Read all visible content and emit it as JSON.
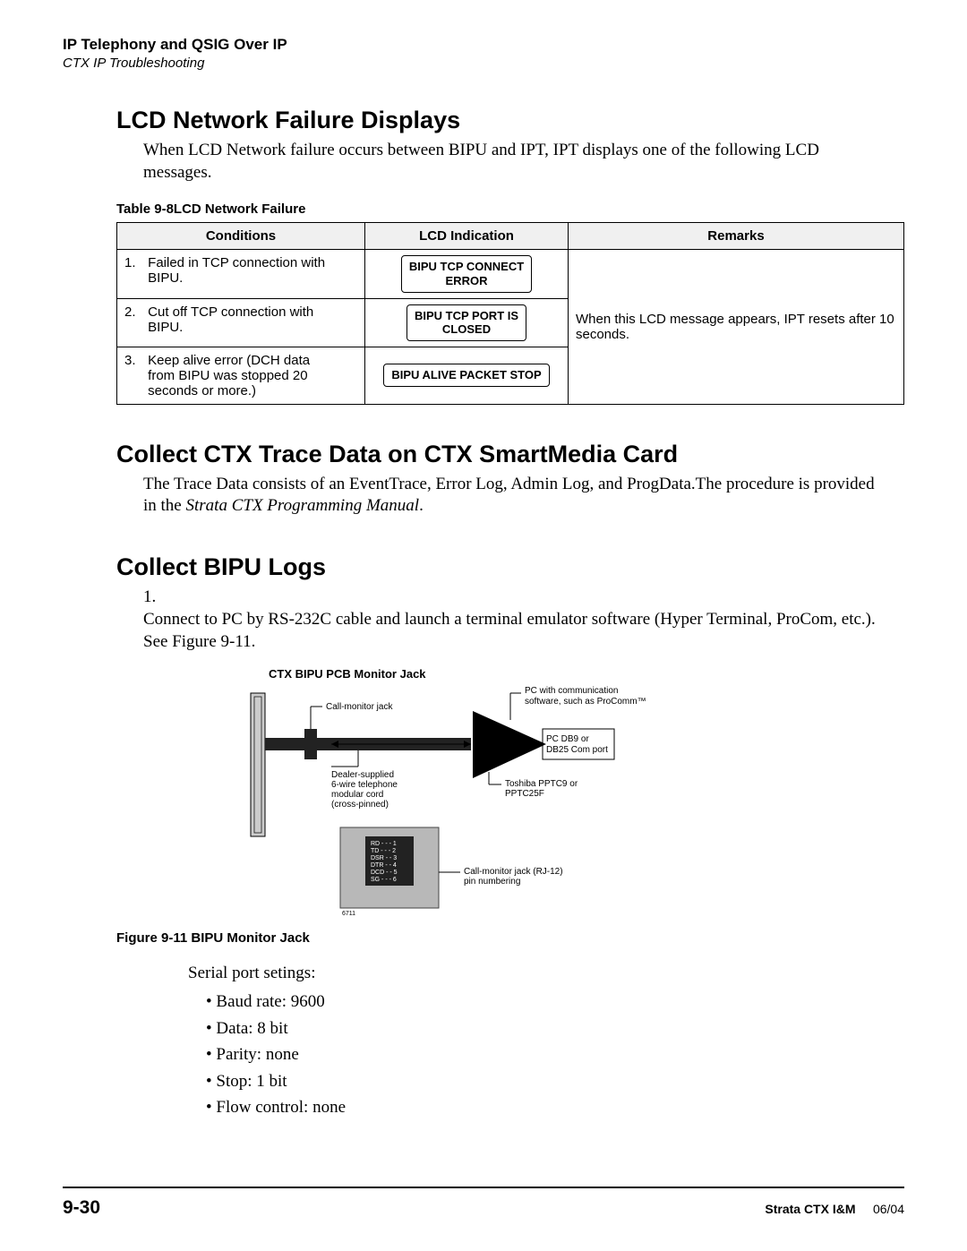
{
  "header": {
    "title": "IP Telephony and QSIG Over IP",
    "subtitle": "CTX IP Troubleshooting"
  },
  "section1": {
    "heading": "LCD Network Failure Displays",
    "paragraph": "When LCD Network failure occurs between BIPU and IPT, IPT displays one of the following LCD messages.",
    "table_caption": "Table 9-8LCD Network Failure",
    "headers": {
      "c1": "Conditions",
      "c2": "LCD Indication",
      "c3": "Remarks"
    },
    "rows": [
      {
        "n": "1.",
        "cond": "Failed in TCP connection with BIPU.",
        "lcd1": "BIPU TCP CONNECT",
        "lcd2": "ERROR"
      },
      {
        "n": "2.",
        "cond": "Cut off TCP connection with BIPU.",
        "lcd1": "BIPU TCP PORT IS",
        "lcd2": "CLOSED"
      },
      {
        "n": "3.",
        "cond": "Keep alive error (DCH data from BIPU was stopped 20 seconds or more.)",
        "lcd1": "BIPU ALIVE PACKET STOP",
        "lcd2": ""
      }
    ],
    "remarks": "When this LCD message appears, IPT resets after 10 seconds."
  },
  "section2": {
    "heading": "Collect CTX Trace Data on CTX SmartMedia Card",
    "p1a": "The Trace Data consists of an EventTrace, Error Log, Admin Log, and ProgData.The procedure is provided in the ",
    "p1b": "Strata CTX Programming Manual",
    "p1c": "."
  },
  "section3": {
    "heading": "Collect BIPU Logs",
    "step1a": "Connect to PC by RS-232C cable and launch a terminal emulator software (Hyper Terminal, ProCom, etc.). See ",
    "step1b": "Figure 9-11.",
    "figure_title": "CTX BIPU PCB Monitor Jack",
    "labels": {
      "call_monitor": "Call-monitor jack",
      "pc_comm1": "PC with communication",
      "pc_comm2": "software, such as ProComm™",
      "db1": "PC DB9 or",
      "db2": "DB25 Com port",
      "dealer1": "Dealer-supplied",
      "dealer2": "6-wire telephone",
      "dealer3": "modular cord",
      "dealer4": "(cross-pinned)",
      "tosh1": "Toshiba PPTC9 or",
      "tosh2": "PPTC25F",
      "pin1": "RD - - - 1",
      "pin2": "TD - - - 2",
      "pin3": "DSR - - 3",
      "pin4": "DTR - - 4",
      "pin5": "DCD - - 5",
      "pin6": "SG - - - 6",
      "rj1": "Call-monitor jack (RJ-12)",
      "rj2": "pin numbering",
      "fignum": "6711"
    },
    "figure_caption": "Figure 9-11   BIPU Monitor Jack",
    "serial_intro": "Serial port setings:",
    "serial": [
      "Baud rate: 9600",
      "Data: 8 bit",
      "Parity: none",
      "Stop: 1 bit",
      "Flow control: none"
    ]
  },
  "footer": {
    "page": "9-30",
    "manual": "Strata CTX I&M",
    "date": "06/04"
  }
}
